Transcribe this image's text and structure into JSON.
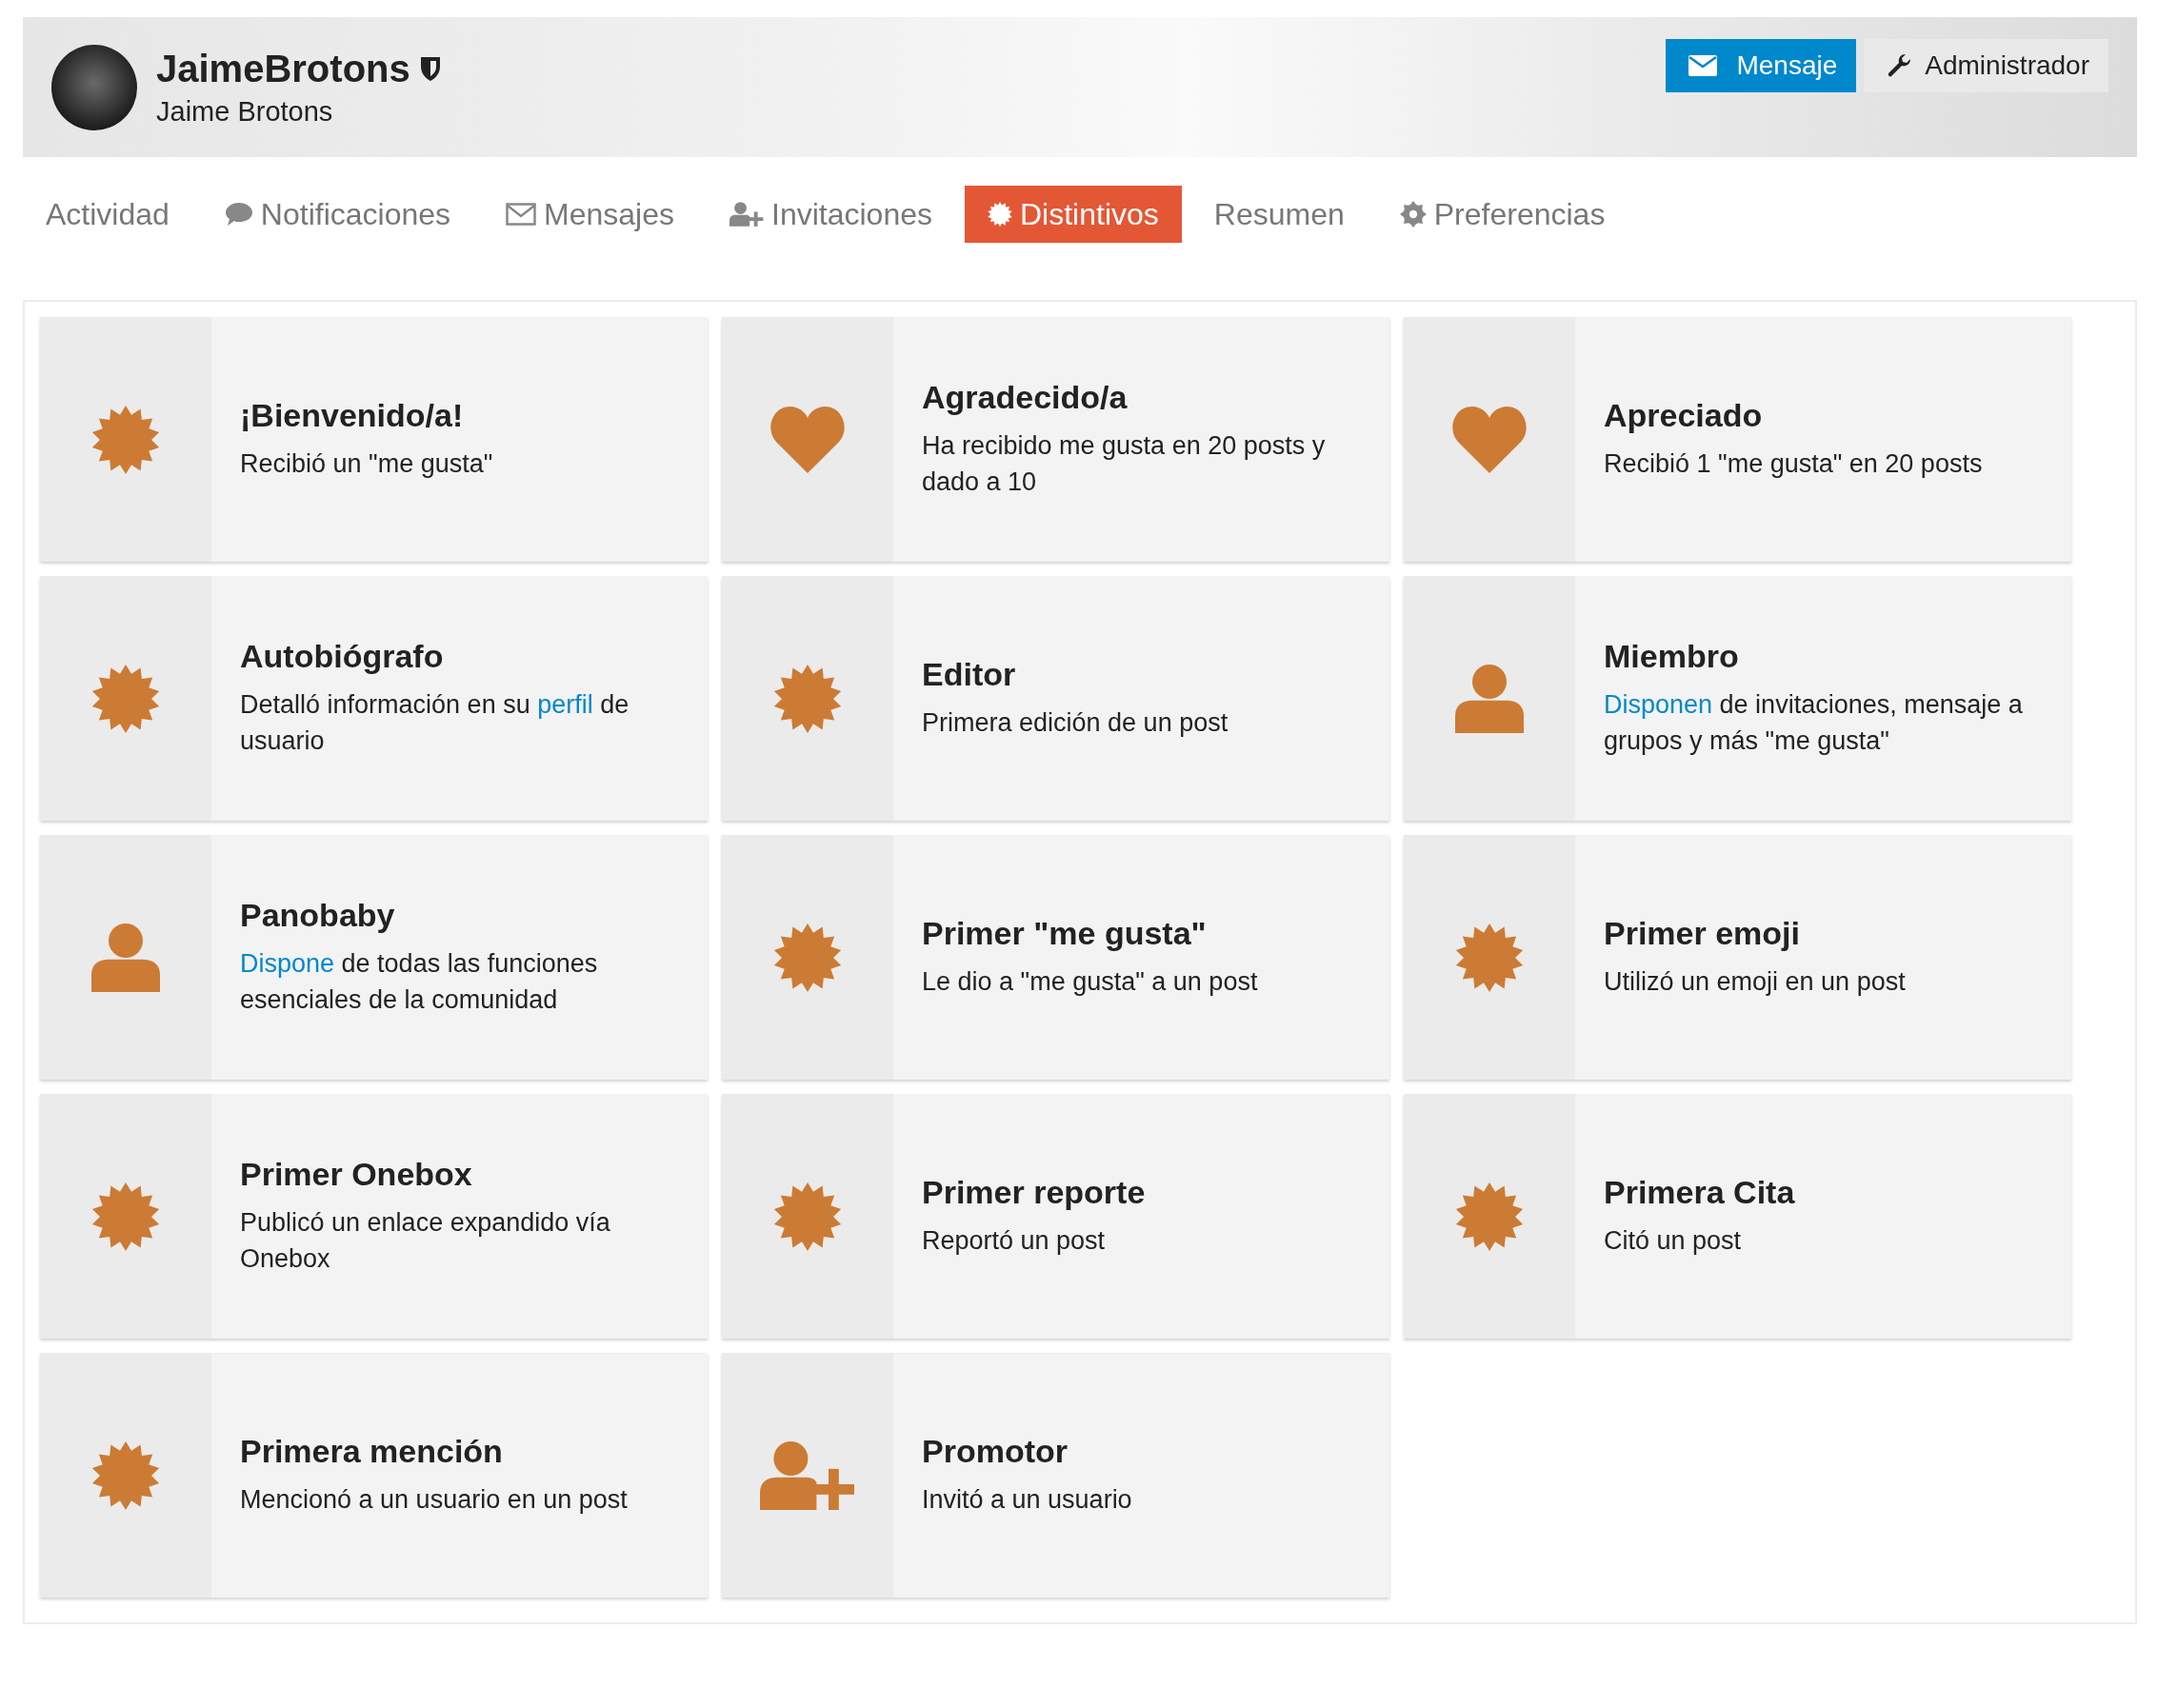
{
  "profile": {
    "username": "JaimeBrotons",
    "full_name": "Jaime Brotons"
  },
  "actions": [
    {
      "kind": "message",
      "label": "Mensaje"
    },
    {
      "kind": "admin",
      "label": "Administrador"
    }
  ],
  "tabs": [
    {
      "kind": "activity",
      "label": "Actividad",
      "selected": false
    },
    {
      "kind": "notifications",
      "label": "Notificaciones",
      "selected": false
    },
    {
      "kind": "messages",
      "label": "Mensajes",
      "selected": false
    },
    {
      "kind": "invitations",
      "label": "Invitaciones",
      "selected": false
    },
    {
      "kind": "badges",
      "label": "Distintivos",
      "selected": true
    },
    {
      "kind": "summary",
      "label": "Resumen",
      "selected": false
    },
    {
      "kind": "preferences",
      "label": "Preferencias",
      "selected": false
    }
  ],
  "badges": [
    {
      "kind": "star",
      "title": "¡Bienvenido/a!",
      "description": [
        {
          "kind": "text",
          "text": "Recibió un \"me gusta\""
        }
      ]
    },
    {
      "kind": "heart",
      "title": "Agradecido/a",
      "description": [
        {
          "kind": "text",
          "text": "Ha recibido me gusta en 20 posts y dado a 10"
        }
      ]
    },
    {
      "kind": "heart",
      "title": "Apreciado",
      "description": [
        {
          "kind": "text",
          "text": "Recibió 1 \"me gusta\" en 20 posts"
        }
      ]
    },
    {
      "kind": "star",
      "title": "Autobiógrafo",
      "description": [
        {
          "kind": "text",
          "text": "Detalló información en su "
        },
        {
          "kind": "link",
          "text": "perfil"
        },
        {
          "kind": "text",
          "text": " de usuario"
        }
      ]
    },
    {
      "kind": "star",
      "title": "Editor",
      "description": [
        {
          "kind": "text",
          "text": "Primera edición de un post"
        }
      ]
    },
    {
      "kind": "user",
      "title": "Miembro",
      "description": [
        {
          "kind": "link",
          "text": "Disponen"
        },
        {
          "kind": "text",
          "text": " de invitaciones, mensaje a grupos y más \"me gusta\""
        }
      ]
    },
    {
      "kind": "user",
      "title": "Panobaby",
      "description": [
        {
          "kind": "link",
          "text": "Dispone"
        },
        {
          "kind": "text",
          "text": " de todas las funciones esenciales de la comunidad"
        }
      ]
    },
    {
      "kind": "star",
      "title": "Primer \"me gusta\"",
      "description": [
        {
          "kind": "text",
          "text": "Le dio a \"me gusta\" a un post"
        }
      ]
    },
    {
      "kind": "star",
      "title": "Primer emoji",
      "description": [
        {
          "kind": "text",
          "text": "Utilizó un emoji en un post"
        }
      ]
    },
    {
      "kind": "star",
      "title": "Primer Onebox",
      "description": [
        {
          "kind": "text",
          "text": "Publicó un enlace expandido vía Onebox"
        }
      ]
    },
    {
      "kind": "star",
      "title": "Primer reporte",
      "description": [
        {
          "kind": "text",
          "text": "Reportó un post"
        }
      ]
    },
    {
      "kind": "star",
      "title": "Primera Cita",
      "description": [
        {
          "kind": "text",
          "text": "Citó un post"
        }
      ]
    },
    {
      "kind": "star",
      "title": "Primera mención",
      "description": [
        {
          "kind": "text",
          "text": "Mencionó a un usuario en un post"
        }
      ]
    },
    {
      "kind": "user-plus",
      "title": "Promotor",
      "description": [
        {
          "kind": "text",
          "text": "Invitó a un usuario"
        }
      ]
    }
  ]
}
